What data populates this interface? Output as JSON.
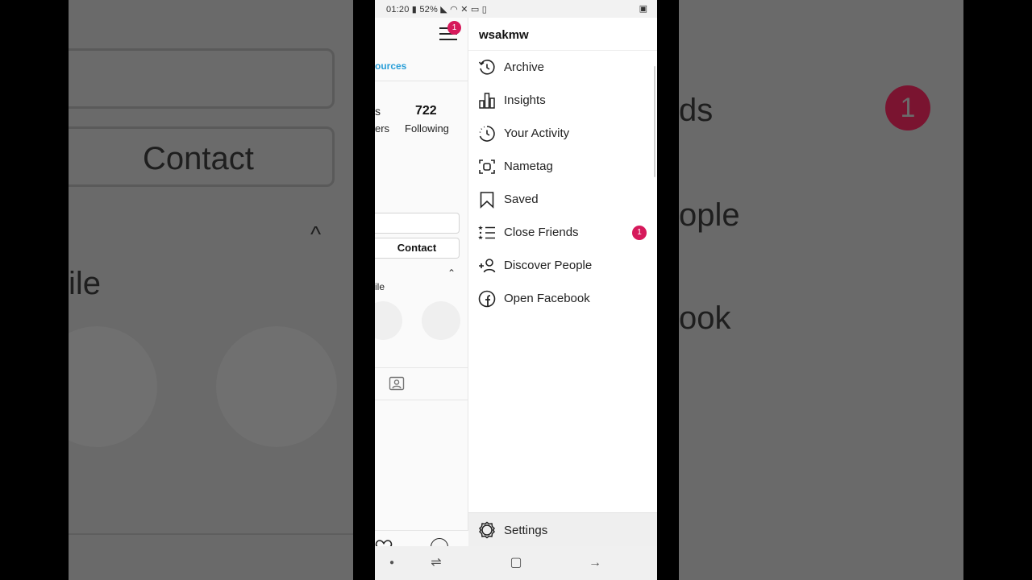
{
  "status_bar": {
    "time": "01:20",
    "battery": "52%",
    "right_icon": "photo-icon"
  },
  "background": {
    "left_contact": "Contact",
    "left_ile": "ile",
    "right_ds": "ds",
    "right_badge": "1",
    "right_ople": "ople",
    "right_ook": "ook"
  },
  "profile": {
    "menu_badge": "1",
    "resources_link": "ources",
    "followers_frag": "ers",
    "followers_num_frag": "s",
    "following_count": "722",
    "following_label": "Following",
    "contact_button": "Contact",
    "highlights_frag": "ile"
  },
  "drawer": {
    "username": "wsakmw",
    "items": [
      {
        "label": "Archive",
        "icon": "archive-icon"
      },
      {
        "label": "Insights",
        "icon": "insights-icon"
      },
      {
        "label": "Your Activity",
        "icon": "activity-icon"
      },
      {
        "label": "Nametag",
        "icon": "nametag-icon"
      },
      {
        "label": "Saved",
        "icon": "bookmark-icon"
      },
      {
        "label": "Close Friends",
        "icon": "close-friends-icon",
        "badge": "1"
      },
      {
        "label": "Discover People",
        "icon": "add-person-icon"
      },
      {
        "label": "Open Facebook",
        "icon": "facebook-icon"
      }
    ],
    "settings_label": "Settings",
    "badge_color": "#d6195b"
  }
}
